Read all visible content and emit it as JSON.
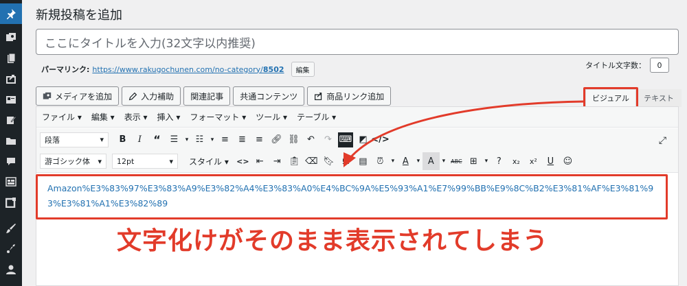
{
  "sidebar": {
    "items": [
      {
        "name": "pin",
        "active": true
      },
      {
        "name": "media"
      },
      {
        "name": "pages"
      },
      {
        "name": "share"
      },
      {
        "name": "card"
      },
      {
        "name": "edit"
      },
      {
        "name": "folder"
      },
      {
        "name": "comment"
      },
      {
        "name": "layout"
      },
      {
        "name": "widget"
      },
      {
        "name": "brush"
      },
      {
        "name": "tools"
      },
      {
        "name": "user"
      }
    ]
  },
  "page": {
    "title": "新規投稿を追加",
    "title_placeholder": "ここにタイトルを入力(32文字以内推奨)"
  },
  "permalink": {
    "label": "パーマリンク:",
    "url": "https://www.rakugochunen.com/no-category/",
    "slug": "8502",
    "edit_button": "編集"
  },
  "title_count": {
    "label": "タイトル文字数：",
    "value": "0"
  },
  "media_buttons": [
    {
      "label": "メディアを追加",
      "icon": "media-icon"
    },
    {
      "label": "入力補助",
      "icon": "pencil-icon"
    },
    {
      "label": "関連記事",
      "icon": ""
    },
    {
      "label": "共通コンテンツ",
      "icon": ""
    },
    {
      "label": "商品リンク追加",
      "icon": "share-icon"
    }
  ],
  "tabs": {
    "visual": "ビジュアル",
    "text": "テキスト"
  },
  "menubar": [
    "ファイル ▾",
    "編集 ▾",
    "表示 ▾",
    "挿入 ▾",
    "フォーマット ▾",
    "ツール ▾",
    "テーブル ▾"
  ],
  "toolbar": {
    "paragraph": "段落",
    "font": "游ゴシック体",
    "size": "12pt",
    "style": "スタイル"
  },
  "content": {
    "text": "Amazon%E3%83%97%E3%83%A9%E3%82%A4%E3%83%A0%E4%BC%9A%E5%93%A1%E7%99%BB%E9%8C%B2%E3%81%AF%E3%81%93%E3%81%A1%E3%82%89"
  },
  "annotation": {
    "caption": "文字化けがそのまま表示されてしまう",
    "color": "#e23b2a"
  },
  "colors": {
    "sidebar": "#1d2327",
    "link": "#2271b1",
    "highlight": "#e23b2a"
  }
}
